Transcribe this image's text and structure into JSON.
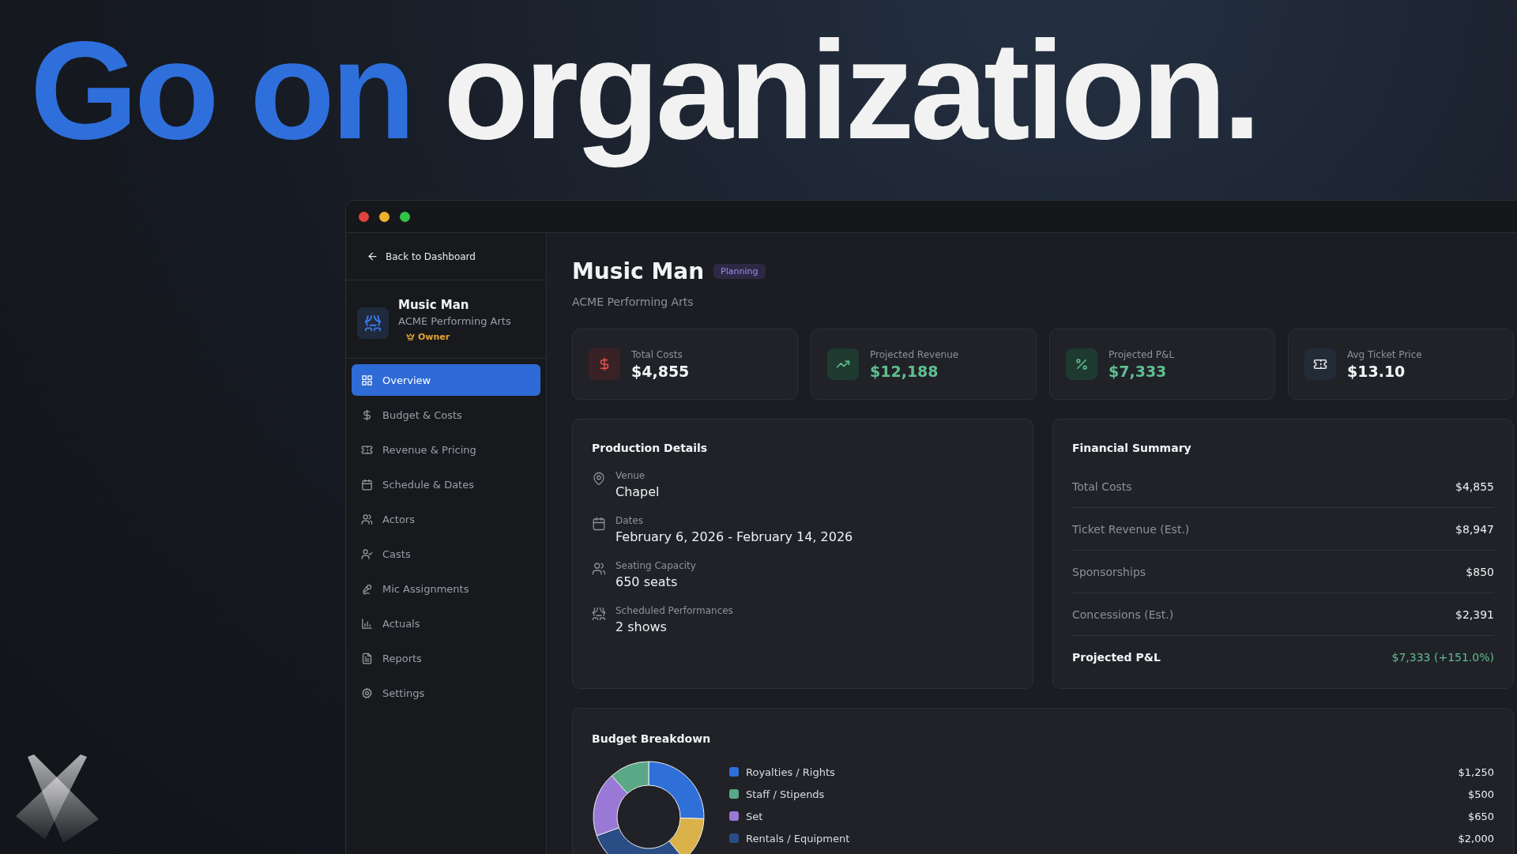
{
  "headline": {
    "accent": "Go on",
    "rest": "organization."
  },
  "sidebar": {
    "back_link": "Back to Dashboard",
    "project": {
      "name": "Music Man",
      "organization": "ACME Performing Arts",
      "role": "Owner"
    },
    "items": [
      {
        "label": "Overview",
        "selected": true
      },
      {
        "label": "Budget & Costs",
        "selected": false
      },
      {
        "label": "Revenue & Pricing",
        "selected": false
      },
      {
        "label": "Schedule & Dates",
        "selected": false
      },
      {
        "label": "Actors",
        "selected": false
      },
      {
        "label": "Casts",
        "selected": false
      },
      {
        "label": "Mic Assignments",
        "selected": false
      },
      {
        "label": "Actuals",
        "selected": false
      },
      {
        "label": "Reports",
        "selected": false
      },
      {
        "label": "Settings",
        "selected": false
      }
    ]
  },
  "header": {
    "title": "Music Man",
    "status": "Planning",
    "subtitle": "ACME Performing Arts"
  },
  "stats": [
    {
      "label": "Total Costs",
      "value": "$4,855"
    },
    {
      "label": "Projected Revenue",
      "value": "$12,188"
    },
    {
      "label": "Projected P&L",
      "value": "$7,333"
    },
    {
      "label": "Avg Ticket Price",
      "value": "$13.10"
    }
  ],
  "production_details": {
    "title": "Production Details",
    "items": [
      {
        "label": "Venue",
        "value": "Chapel"
      },
      {
        "label": "Dates",
        "value": "February 6, 2026 - February 14, 2026"
      },
      {
        "label": "Seating Capacity",
        "value": "650 seats"
      },
      {
        "label": "Scheduled Performances",
        "value": "2 shows"
      }
    ]
  },
  "financial_summary": {
    "title": "Financial Summary",
    "rows": [
      {
        "label": "Total Costs",
        "value": "$4,855",
        "kind": "line"
      },
      {
        "label": "Ticket Revenue (Est.)",
        "value": "$8,947",
        "kind": "line"
      },
      {
        "label": "Sponsorships",
        "value": "$850",
        "kind": "line"
      },
      {
        "label": "Concessions (Est.)",
        "value": "$2,391",
        "kind": "line"
      },
      {
        "label": "Projected P&L",
        "value": "$7,333 (+151.0%)",
        "kind": "total"
      }
    ]
  },
  "budget_breakdown": {
    "title": "Budget Breakdown",
    "legend": [
      {
        "label": "Royalties / Rights",
        "amount": "$1,250",
        "color": "#2f6fd8"
      },
      {
        "label": "Staff / Stipends",
        "amount": "$500",
        "color": "#5aa886"
      },
      {
        "label": "Set",
        "amount": "$650",
        "color": "#9a78d6"
      },
      {
        "label": "Rentals / Equipment",
        "amount": "$2,000",
        "color": "#2a4d85"
      }
    ]
  }
}
